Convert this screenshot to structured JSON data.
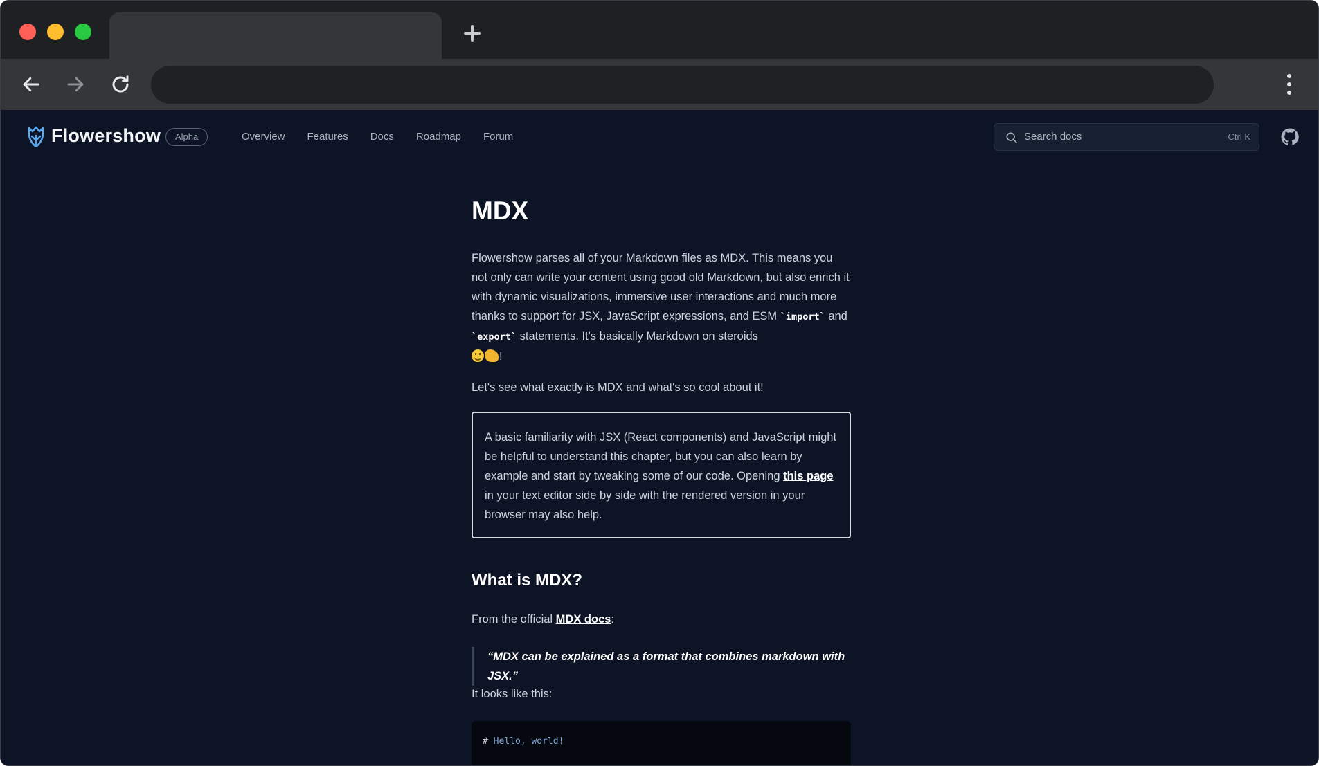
{
  "browser": {
    "tab_title": "",
    "address": ""
  },
  "site": {
    "brand": "Flowershow",
    "badge": "Alpha",
    "nav": [
      "Overview",
      "Features",
      "Docs",
      "Roadmap",
      "Forum"
    ],
    "search": {
      "placeholder": "Search docs",
      "shortcut": "Ctrl K"
    }
  },
  "article": {
    "title": "MDX",
    "intro": {
      "part1": "Flowershow parses all of your Markdown files as MDX. This means you not only can write your content using good old Markdown, but also enrich it with dynamic visualizations, immersive user interactions and much more thanks to support for JSX, JavaScript expressions, and ESM ",
      "code1": "`import`",
      "and": " and ",
      "code2": "`export`",
      "part2": " statements. It's basically Markdown on steroids ",
      "end": "!"
    },
    "lead": "Let's see what exactly is MDX and what's so cool about it!",
    "callout": {
      "before": "A basic familiarity with JSX (React components) and JavaScript might be helpful to understand this chapter, but you can also learn by example and start by tweaking some of our code. Opening ",
      "link": "this page",
      "after": " in your text editor side by side with the rendered version in your browser may also help."
    },
    "section_title": "What is MDX?",
    "from": {
      "before": "From the official ",
      "link": "MDX docs",
      "after": ":"
    },
    "quote": "“MDX can be explained as a format that combines markdown with JSX.”",
    "looks": "It looks like this:",
    "code": {
      "hash": "#",
      "heading": "Hello, world!"
    }
  },
  "colors": {
    "page_background": "#0d1426",
    "accent_logo": "#5aa9f0"
  }
}
